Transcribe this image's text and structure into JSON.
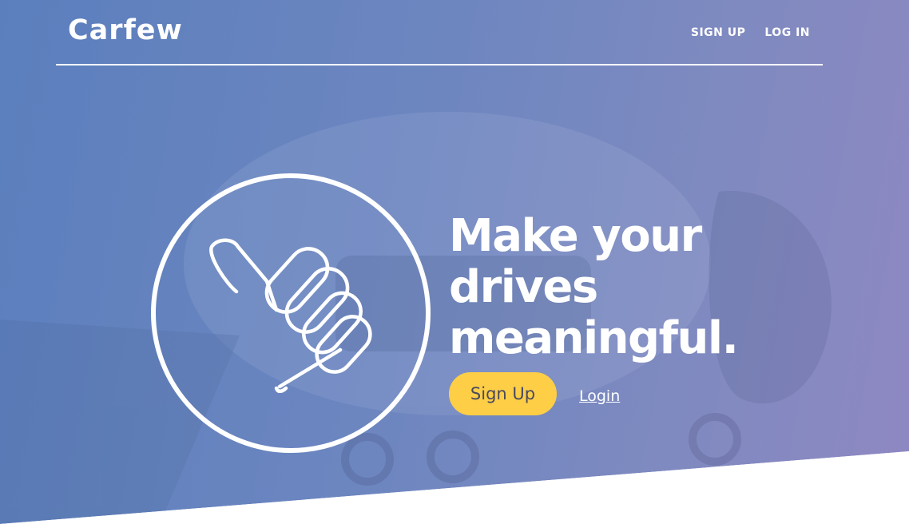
{
  "brand": {
    "name": "Carfew"
  },
  "nav": {
    "signup_label": "SIGN UP",
    "login_label": "LOG IN"
  },
  "hero": {
    "headline_lines": [
      "Make your",
      "drives",
      "meaningful."
    ],
    "signup_button": "Sign Up",
    "login_link": "Login",
    "icon": "thumbs-up-icon"
  },
  "colors": {
    "gradient_start": "#5b7fbd",
    "gradient_end": "#8f88c2",
    "accent_button": "#fdce46",
    "button_text": "#4a4a5e",
    "text": "#ffffff"
  }
}
